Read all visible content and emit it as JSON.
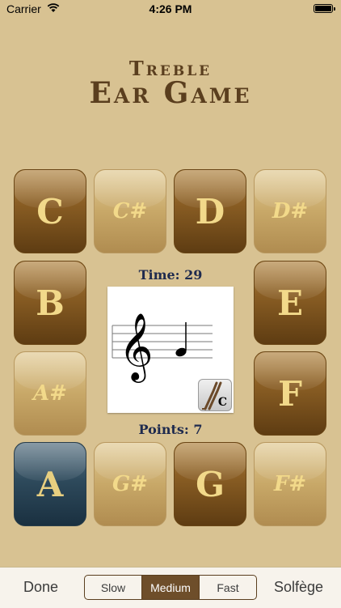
{
  "status": {
    "carrier": "Carrier",
    "time": "4:26 PM",
    "battery_level": 1.0
  },
  "title": {
    "line1": "Treble",
    "line2": "Ear Game"
  },
  "keys": [
    {
      "note": "C",
      "type": "natural"
    },
    {
      "note": "C#",
      "type": "accidental"
    },
    {
      "note": "D",
      "type": "natural"
    },
    {
      "note": "D#",
      "type": "accidental"
    },
    {
      "note": "B",
      "type": "natural"
    },
    {
      "note": "E",
      "type": "natural"
    },
    {
      "note": "A#",
      "type": "accidental"
    },
    {
      "note": "F",
      "type": "natural"
    },
    {
      "note": "A",
      "type": "selected"
    },
    {
      "note": "G#",
      "type": "accidental"
    },
    {
      "note": "G",
      "type": "natural"
    },
    {
      "note": "F#",
      "type": "accidental"
    }
  ],
  "time_label": "Time: 29",
  "points_label": "Points: 7",
  "fork_label": "C",
  "toolbar": {
    "done": "Done",
    "speeds": [
      "Slow",
      "Medium",
      "Fast"
    ],
    "selected_speed": "Medium",
    "solfege": "Solfège"
  },
  "icons": {
    "wifi": "wifi-icon",
    "battery": "battery-icon",
    "fork": "tuning-fork-icon",
    "clef": "treble-clef-icon"
  },
  "colors": {
    "background": "#d8c292",
    "title": "#5a3e1e",
    "label": "#1e2a4e",
    "selected_key": "#2e4a5c",
    "key_text": "#f2d98a"
  }
}
